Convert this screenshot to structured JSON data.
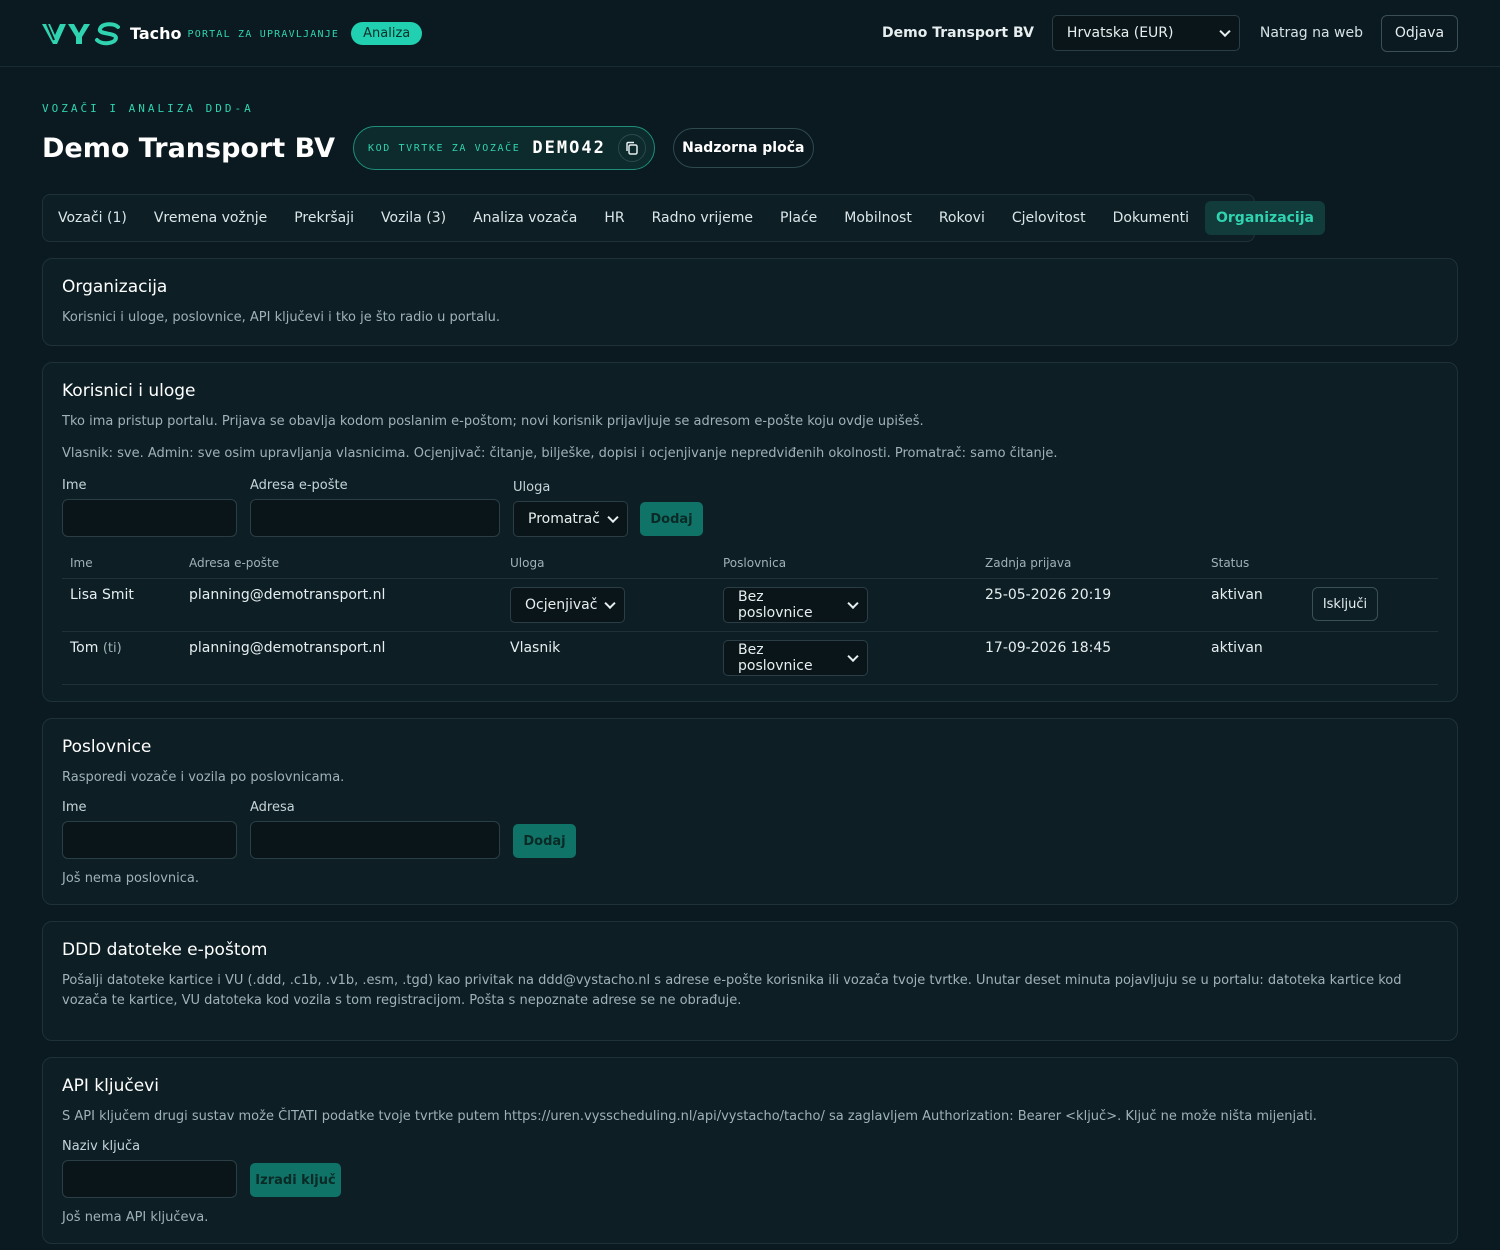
{
  "header": {
    "logo_text": "VYS",
    "tacho": "Tacho",
    "portal": "PORTAL ZA UPRAVLJANJE",
    "badge": "Analiza",
    "company": "Demo Transport BV",
    "region": "Hrvatska (EUR)",
    "back_link": "Natrag na web",
    "logout": "Odjava"
  },
  "page": {
    "breadcrumb": "VOZAČI I ANALIZA DDD-A",
    "title": "Demo Transport BV",
    "code_label": "KOD TVRTKE ZA VOZAČE",
    "code_value": "DEMO42",
    "dashboard": "Nadzorna ploča"
  },
  "tabs": [
    {
      "label": "Vozači (1)"
    },
    {
      "label": "Vremena vožnje"
    },
    {
      "label": "Prekršaji"
    },
    {
      "label": "Vozila (3)"
    },
    {
      "label": "Analiza vozača"
    },
    {
      "label": "HR"
    },
    {
      "label": "Radno vrijeme"
    },
    {
      "label": "Plaće"
    },
    {
      "label": "Mobilnost"
    },
    {
      "label": "Rokovi"
    },
    {
      "label": "Cjelovitost"
    },
    {
      "label": "Dokumenti"
    },
    {
      "label": "Organizacija"
    }
  ],
  "org": {
    "title": "Organizacija",
    "desc": "Korisnici i uloge, poslovnice, API ključevi i tko je što radio u portalu."
  },
  "users": {
    "title": "Korisnici i uloge",
    "desc1": "Tko ima pristup portalu. Prijava se obavlja kodom poslanim e-poštom; novi korisnik prijavljuje se adresom e-pošte koju ovdje upišeš.",
    "desc2": "Vlasnik: sve. Admin: sve osim upravljanja vlasnicima. Ocjenjivač: čitanje, bilješke, dopisi i ocjenjivanje nepredviđenih okolnosti. Promatrač: samo čitanje.",
    "label_name": "Ime",
    "label_email": "Adresa e-pošte",
    "label_role": "Uloga",
    "role_default": "Promatrač",
    "add": "Dodaj",
    "columns": [
      "Ime",
      "Adresa e-pošte",
      "Uloga",
      "Poslovnica",
      "Zadnja prijava",
      "Status"
    ],
    "rows": [
      {
        "name": "Lisa Smit",
        "you": "",
        "email": "planning@demotransport.nl",
        "role": "Ocjenjivač",
        "branch": "Bez poslovnice",
        "last_login": "25-05-2026 20:19",
        "status": "aktivan",
        "action": "Isključi"
      },
      {
        "name": "Tom",
        "you": "(ti)",
        "email": "planning@demotransport.nl",
        "role": "Vlasnik",
        "branch": "Bez poslovnice",
        "last_login": "17-09-2026 18:45",
        "status": "aktivan",
        "action": ""
      }
    ]
  },
  "branches": {
    "title": "Poslovnice",
    "desc": "Rasporedi vozače i vozila po poslovnicama.",
    "label_name": "Ime",
    "label_address": "Adresa",
    "add": "Dodaj",
    "empty": "Još nema poslovnica."
  },
  "ddd": {
    "title": "DDD datoteke e-poštom",
    "desc": "Pošalji datoteke kartice i VU (.ddd, .c1b, .v1b, .esm, .tgd) kao privitak na ddd@vystacho.nl s adrese e-pošte korisnika ili vozača tvoje tvrtke. Unutar deset minuta pojavljuju se u portalu: datoteka kartice kod vozača te kartice, VU datoteka kod vozila s tom registracijom. Pošta s nepoznate adrese se ne obrađuje."
  },
  "api": {
    "title": "API ključevi",
    "desc": "S API ključem drugi sustav može ČITATI podatke tvoje tvrtke putem https://uren.vysscheduling.nl/api/vystacho/tacho/ sa zaglavljem Authorization: Bearer <ključ>. Ključ ne može ništa mijenjati.",
    "label_name": "Naziv ključa",
    "create": "Izradi ključ",
    "empty": "Još nema API ključeva."
  }
}
